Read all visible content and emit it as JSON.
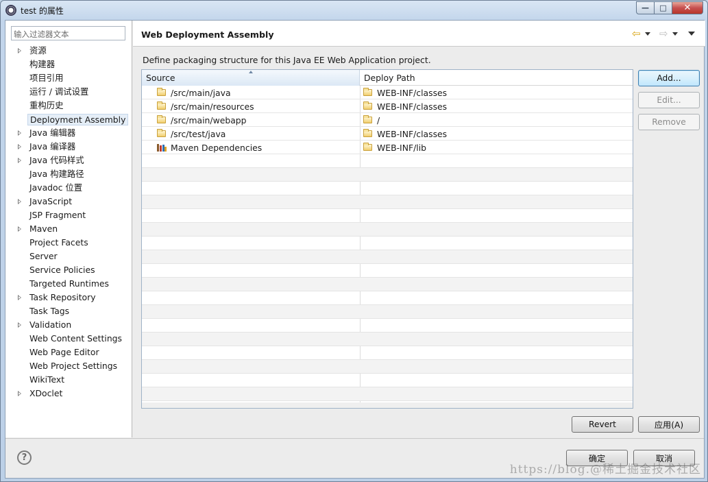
{
  "window": {
    "title": "test 的属性"
  },
  "titlebar": {
    "min_glyph": "—",
    "max_glyph": "□",
    "close_glyph": "✕"
  },
  "nav": {
    "filter_placeholder": "输入过滤器文本",
    "items": [
      {
        "label": "资源",
        "expandable": true
      },
      {
        "label": "构建器",
        "expandable": false
      },
      {
        "label": "项目引用",
        "expandable": false
      },
      {
        "label": "运行 / 调试设置",
        "expandable": false
      },
      {
        "label": "重构历史",
        "expandable": false
      },
      {
        "label": "Deployment Assembly",
        "expandable": false,
        "selected": true
      },
      {
        "label": "Java 编辑器",
        "expandable": true
      },
      {
        "label": "Java 编译器",
        "expandable": true
      },
      {
        "label": "Java 代码样式",
        "expandable": true
      },
      {
        "label": "Java 构建路径",
        "expandable": false
      },
      {
        "label": "Javadoc 位置",
        "expandable": false
      },
      {
        "label": "JavaScript",
        "expandable": true
      },
      {
        "label": "JSP Fragment",
        "expandable": false
      },
      {
        "label": "Maven",
        "expandable": true
      },
      {
        "label": "Project Facets",
        "expandable": false
      },
      {
        "label": "Server",
        "expandable": false
      },
      {
        "label": "Service Policies",
        "expandable": false
      },
      {
        "label": "Targeted Runtimes",
        "expandable": false
      },
      {
        "label": "Task Repository",
        "expandable": true
      },
      {
        "label": "Task Tags",
        "expandable": false
      },
      {
        "label": "Validation",
        "expandable": true
      },
      {
        "label": "Web Content Settings",
        "expandable": false
      },
      {
        "label": "Web Page Editor",
        "expandable": false
      },
      {
        "label": "Web Project Settings",
        "expandable": false
      },
      {
        "label": "WikiText",
        "expandable": false
      },
      {
        "label": "XDoclet",
        "expandable": true
      }
    ]
  },
  "page": {
    "title": "Web Deployment Assembly",
    "description": "Define packaging structure for this Java EE Web Application project.",
    "back_icon": "arrow-left-icon",
    "forward_icon": "arrow-right-icon",
    "table": {
      "columns": [
        "Source",
        "Deploy Path"
      ],
      "rows": [
        {
          "source": "/src/main/java",
          "source_icon": "folder",
          "deploy": "WEB-INF/classes"
        },
        {
          "source": "/src/main/resources",
          "source_icon": "folder",
          "deploy": "WEB-INF/classes"
        },
        {
          "source": "/src/main/webapp",
          "source_icon": "folder",
          "deploy": "/"
        },
        {
          "source": "/src/test/java",
          "source_icon": "folder",
          "deploy": "WEB-INF/classes"
        },
        {
          "source": "Maven Dependencies",
          "source_icon": "library",
          "deploy": "WEB-INF/lib"
        }
      ],
      "empty_rows": 18
    },
    "buttons": {
      "add": "Add...",
      "edit": "Edit...",
      "remove": "Remove",
      "revert": "Revert",
      "apply": "应用(A)"
    }
  },
  "footer": {
    "help_glyph": "?",
    "ok": "确定",
    "cancel": "取消",
    "watermark": "https://blog.@稀土掘金技术社区"
  },
  "colors": {
    "accent": "#3c7fb1",
    "selection": "#e5eef7",
    "folder": "#f1cf6e",
    "close": "#c75050"
  }
}
